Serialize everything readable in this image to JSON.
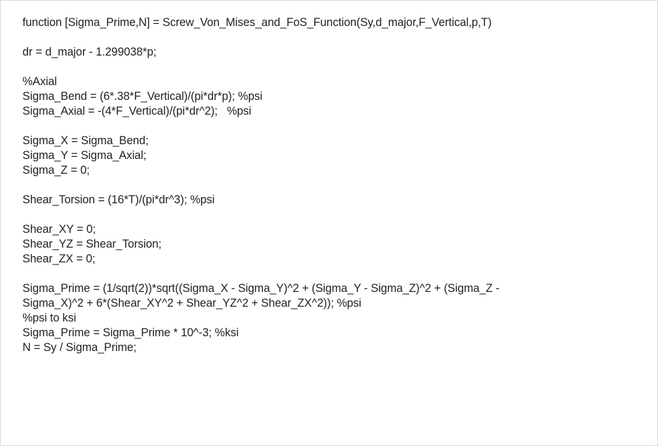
{
  "code": {
    "lines": [
      "function [Sigma_Prime,N] = Screw_Von_Mises_and_FoS_Function(Sy,d_major,F_Vertical,p,T)",
      "",
      "dr = d_major - 1.299038*p;",
      "",
      "%Axial",
      "Sigma_Bend = (6*.38*F_Vertical)/(pi*dr*p); %psi",
      "Sigma_Axial = -(4*F_Vertical)/(pi*dr^2);   %psi",
      "",
      "Sigma_X = Sigma_Bend;",
      "Sigma_Y = Sigma_Axial;",
      "Sigma_Z = 0;",
      "",
      "Shear_Torsion = (16*T)/(pi*dr^3); %psi",
      "",
      "Shear_XY = 0;",
      "Shear_YZ = Shear_Torsion;",
      "Shear_ZX = 0;",
      "",
      "Sigma_Prime = (1/sqrt(2))*sqrt((Sigma_X - Sigma_Y)^2 + (Sigma_Y - Sigma_Z)^2 + (Sigma_Z -",
      "Sigma_X)^2 + 6*(Shear_XY^2 + Shear_YZ^2 + Shear_ZX^2)); %psi",
      "%psi to ksi",
      "Sigma_Prime = Sigma_Prime * 10^-3; %ksi",
      "N = Sy / Sigma_Prime;"
    ]
  }
}
